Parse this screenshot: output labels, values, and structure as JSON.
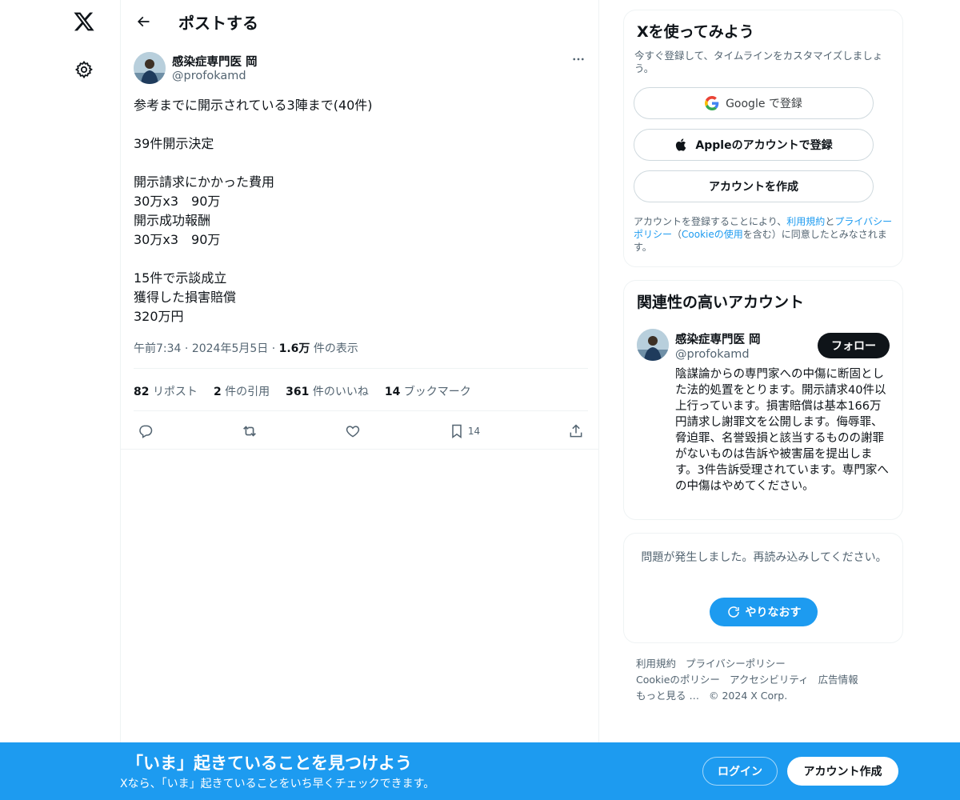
{
  "header": {
    "title": "ポストする"
  },
  "tweet": {
    "author_name": "感染症専門医 岡",
    "author_handle": "@profokamd",
    "body": "参考までに開示されている3陣まで(40件)\n\n39件開示決定\n\n開示請求にかかった費用\n30万x3　90万\n開示成功報酬\n30万x3　90万\n\n15件で示談成立\n獲得した損害賠償\n320万円",
    "time": "午前7:34",
    "date": "2024年5月5日",
    "views_num": "1.6万",
    "views_label": "件の表示",
    "stats": {
      "reposts_num": "82",
      "reposts_label": "リポスト",
      "quotes_num": "2",
      "quotes_label": "件の引用",
      "likes_num": "361",
      "likes_label": "件のいいね",
      "bookmarks_num": "14",
      "bookmarks_label": "ブックマーク"
    },
    "bookmark_count": "14"
  },
  "signup_card": {
    "title": "Xを使ってみよう",
    "subtitle": "今すぐ登録して、タイムラインをカスタマイズしましょう。",
    "google_label": "Google で登録",
    "apple_label": "Appleのアカウントで登録",
    "create_label": "アカウントを作成",
    "legal_prefix": "アカウントを登録することにより、",
    "legal_terms": "利用規約",
    "legal_and": "と",
    "legal_privacy": "プライバシーポリシー",
    "legal_open": "（",
    "legal_cookie": "Cookieの使用",
    "legal_suffix": "を含む）に同意したとみなされます。"
  },
  "related_card": {
    "title": "関連性の高いアカウント",
    "name": "感染症専門医 岡",
    "handle": "@profokamd",
    "follow_label": "フォロー",
    "bio": "陰謀論からの専門家への中傷に断固とした法的処置をとります。開示請求40件以上行っています。損害賠償は基本166万円請求し謝罪文を公開します。侮辱罪、脅迫罪、名誉毀損と該当するものの謝罪がないものは告訴や被害届を提出します。3件告訴受理されています。専門家への中傷はやめてください。"
  },
  "error_card": {
    "message": "問題が発生しました。再読み込みしてください。",
    "retry_label": "やりなおす"
  },
  "footer": {
    "links": [
      "利用規約",
      "プライバシーポリシー",
      "Cookieのポリシー",
      "アクセシビリティ",
      "広告情報",
      "もっと見る …",
      "© 2024 X Corp."
    ]
  },
  "bottom_bar": {
    "title": "「いま」起きていることを見つけよう",
    "subtitle": "Xなら、「いま」起きていることをいち早くチェックできます。",
    "login_label": "ログイン",
    "signup_label": "アカウント作成"
  },
  "colors": {
    "accent": "#1d9bf0",
    "text": "#0f1419",
    "muted": "#536471",
    "border": "#eff3f4"
  },
  "icons": [
    "x-logo-icon",
    "gear-icon",
    "back-arrow-icon",
    "more-icon",
    "reply-icon",
    "repost-icon",
    "like-icon",
    "bookmark-icon",
    "share-icon",
    "google-icon",
    "apple-icon",
    "refresh-icon"
  ]
}
